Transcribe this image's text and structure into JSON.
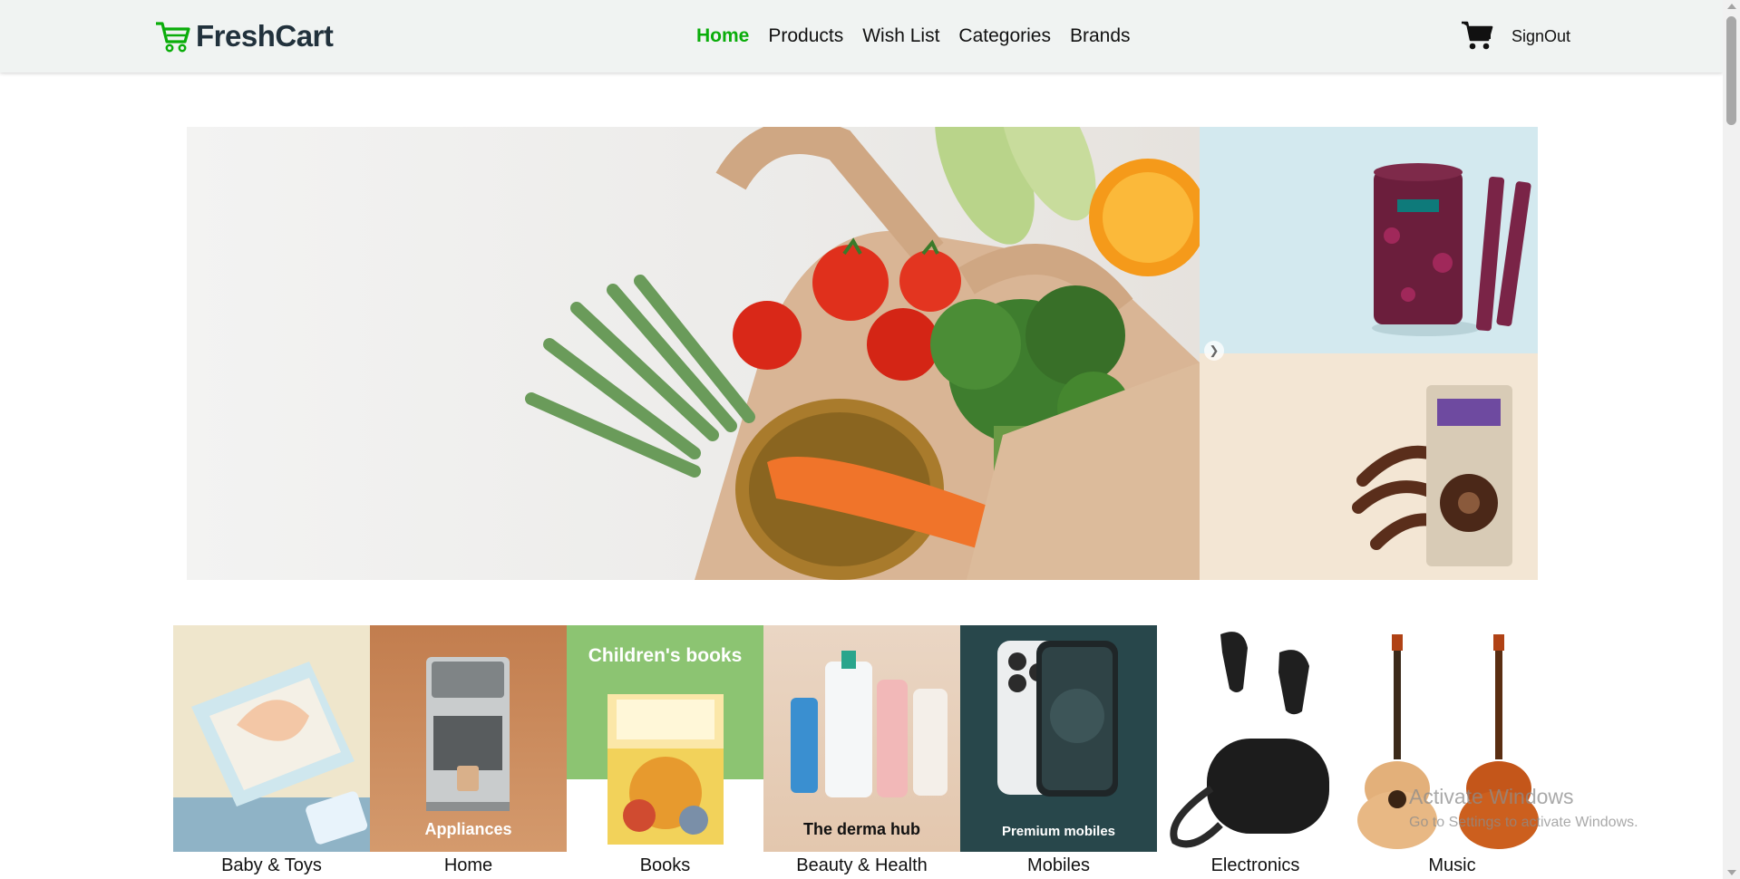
{
  "header": {
    "brand": "FreshCart",
    "nav": [
      {
        "label": "Home",
        "active": true
      },
      {
        "label": "Products",
        "active": false
      },
      {
        "label": "Wish List",
        "active": false
      },
      {
        "label": "Categories",
        "active": false
      },
      {
        "label": "Brands",
        "active": false
      }
    ],
    "cart_icon": "shopping-cart-icon",
    "signout_label": "SignOut",
    "accent_color": "#0aad0a"
  },
  "hero": {
    "next_icon": "chevron-right-icon"
  },
  "categories": [
    {
      "name": "Baby & Toys",
      "caption": ""
    },
    {
      "name": "Home",
      "caption": "Appliances"
    },
    {
      "name": "Books",
      "caption": "Children's books"
    },
    {
      "name": "Beauty & Health",
      "caption": "The derma hub"
    },
    {
      "name": "Mobiles",
      "caption": "Premium mobiles"
    },
    {
      "name": "Electronics",
      "caption": ""
    },
    {
      "name": "Music",
      "caption": ""
    }
  ],
  "watermark": {
    "line1": "Activate Windows",
    "line2": "Go to Settings to activate Windows."
  }
}
